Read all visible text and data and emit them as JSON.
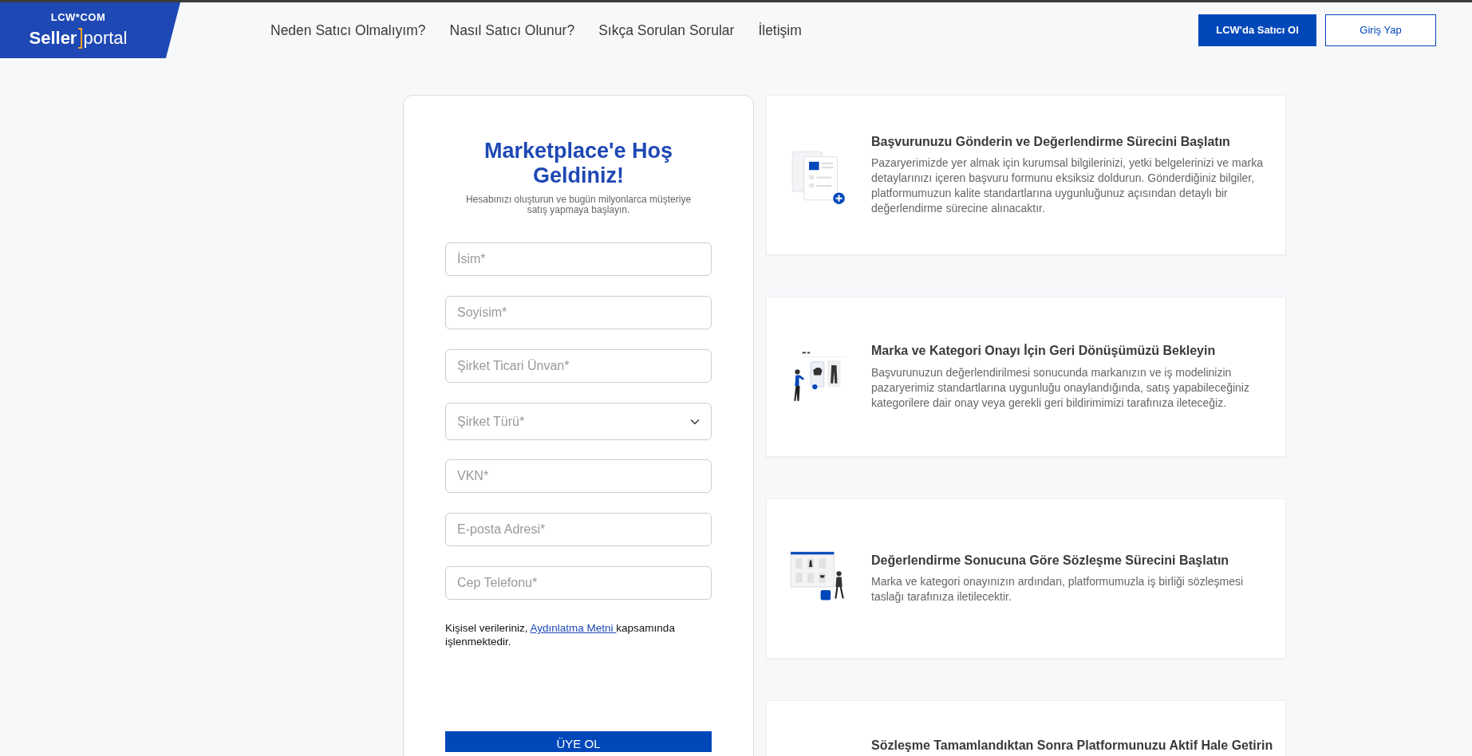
{
  "header": {
    "logo": {
      "brand": "LCW*COM",
      "bold": "Seller",
      "light": "portal"
    },
    "nav": [
      {
        "label": "Neden Satıcı Olmalıyım?"
      },
      {
        "label": "Nasıl Satıcı Olunur?"
      },
      {
        "label": "Sıkça Sorulan Sorular"
      },
      {
        "label": "İletişim"
      }
    ],
    "buttons": [
      {
        "label": "LCW'da Satıcı Ol",
        "kind": "primary"
      },
      {
        "label": "Giriş Yap",
        "kind": "outline"
      }
    ]
  },
  "form": {
    "title": "Marketplace'e Hoş Geldiniz!",
    "subtitle": "Hesabınızı oluşturun ve bugün milyonlarca müşteriye satış yapmaya başlayın.",
    "fields": [
      {
        "kind": "text",
        "placeholder": "İsim*"
      },
      {
        "kind": "text",
        "placeholder": "Soyisim*"
      },
      {
        "kind": "text",
        "placeholder": "Şirket Ticari Ünvan*"
      },
      {
        "kind": "select",
        "placeholder": "Şirket Türü*"
      },
      {
        "kind": "text",
        "placeholder": "VKN*"
      },
      {
        "kind": "text",
        "placeholder": "E-posta Adresi*"
      },
      {
        "kind": "text",
        "placeholder": "Cep Telefonu*"
      }
    ],
    "consent": {
      "before": "Kişisel verileriniz, ",
      "link": "Aydınlatma Metni ",
      "after": "kapsamında işlenmektedir."
    },
    "submit": "ÜYE OL"
  },
  "steps": [
    {
      "kind": "form",
      "title": "Başvurunuzu Gönderin ve Değerlendirme Sürecini Başlatın",
      "text": "Pazaryerimizde yer almak için kurumsal bilgilerinizi, yetki belgelerinizi ve marka detaylarınızı içeren başvuru formunu eksiksiz doldurun. Gönderdiğiniz bilgiler, platformumuzun kalite standartlarına uygunluğunuz açısından detaylı bir değerlendirme sürecine alınacaktır."
    },
    {
      "kind": "review",
      "title": "Marka ve Kategori Onayı İçin Geri Dönüşümüzü Bekleyin",
      "text": "Başvurunuzun değerlendirilmesi sonucunda markanızın ve iş modelinizin pazaryerimiz standartlarına uygunluğu onaylandığında, satış yapabileceğiniz kategorilere dair onay veya gerekli geri bildirimimizi tarafınıza ileteceğiz."
    },
    {
      "kind": "store",
      "title": "Değerlendirme Sonucuna Göre Sözleşme Sürecini Başlatın",
      "text": "Marka ve kategori onayınızın ardından, platformumuzla iş birliği sözleşmesi taslağı tarafınıza iletilecektir."
    },
    {
      "kind": "none",
      "title": "Sözleşme Tamamlandıktan Sonra Platformunuzu Aktif Hale Getirin"
    }
  ]
}
